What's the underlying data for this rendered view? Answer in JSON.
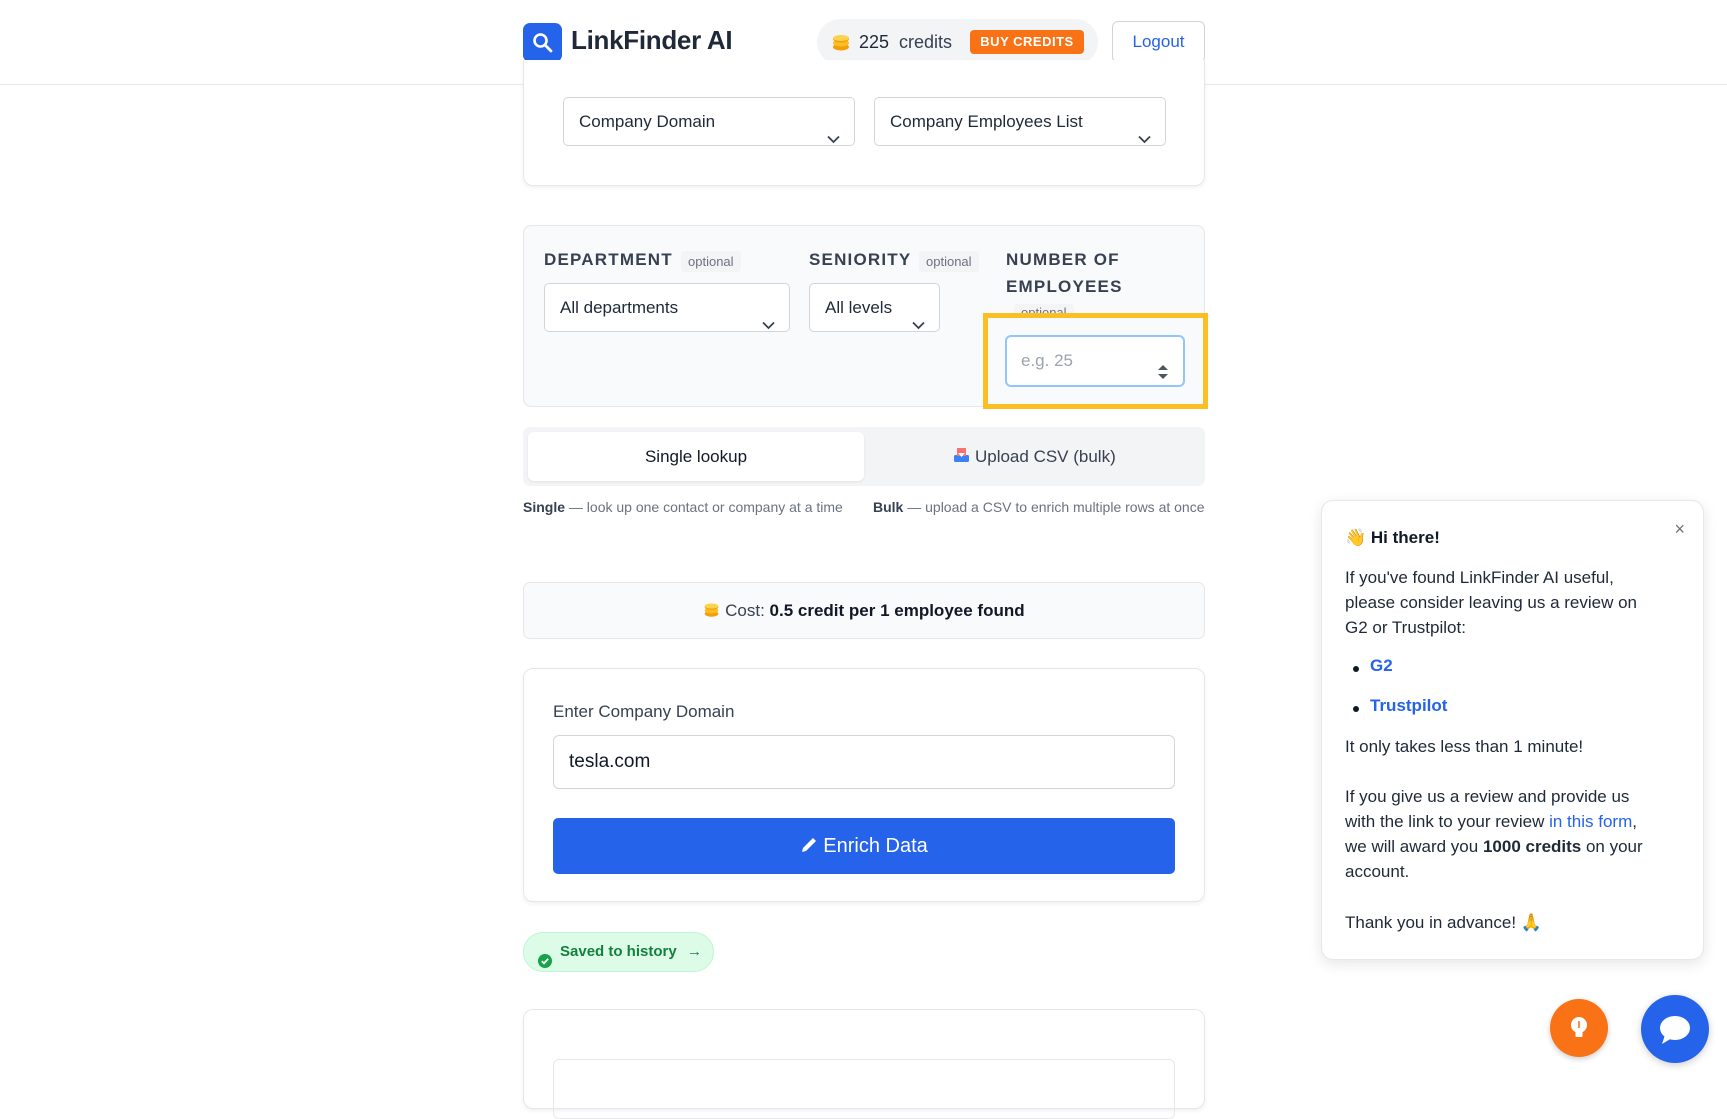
{
  "header": {
    "brand": "LinkFinder AI",
    "credits_count": "225",
    "credits_word": "credits",
    "buy_label": "BUY CREDITS",
    "logout_label": "Logout"
  },
  "source_selects": {
    "source_value": "Company Domain",
    "output_value": "Company Employees List"
  },
  "filters": {
    "department_label": "DEPARTMENT",
    "department_badge": "optional",
    "department_value": "All departments",
    "seniority_label": "SENIORITY",
    "seniority_badge": "optional",
    "seniority_value": "All levels",
    "employees_label_line1": "NUMBER OF",
    "employees_label_line2": "EMPLOYEES",
    "employees_badge": "optional",
    "employees_placeholder": "e.g. 25"
  },
  "mode_tabs": {
    "single_label": "Single lookup",
    "bulk_label": "Upload CSV (bulk)",
    "single_desc_bold": "Single",
    "single_desc": " — look up one contact or company at a time",
    "bulk_desc_bold": "Bulk",
    "bulk_desc": " — upload a CSV to enrich multiple rows at once"
  },
  "cost": {
    "prefix": "Cost: ",
    "value": "0.5 credit per 1 employee found"
  },
  "input_card": {
    "label": "Enter Company Domain",
    "value": "tesla.com",
    "button_label": "Enrich Data"
  },
  "saved": {
    "label": "Saved to history",
    "arrow": "→"
  },
  "popup": {
    "title_emoji": "👋",
    "title": "Hi there!",
    "close": "×",
    "intro_line1": "If you've found LinkFinder AI useful,",
    "intro_line2": "please consider leaving us a review on",
    "intro_line3": "G2 or Trustpilot:",
    "link_g2": "G2",
    "link_trustpilot": "Trustpilot",
    "time_note": "It only takes less than 1 minute!",
    "offer_line1": "If you give us a review and provide us",
    "offer_line2_a": "with the link to your review ",
    "offer_line2_link": "in this form",
    "offer_line2_b": ",",
    "offer_line3_a": "we will award you ",
    "offer_line3_bold": "1000 credits",
    "offer_line3_b": " on your",
    "offer_line4": "account.",
    "thanks": "Thank you in advance! 🙏"
  },
  "colors": {
    "primary": "#2563eb",
    "accent_orange": "#f97316",
    "highlight": "#fbbf24",
    "success": "#15803d"
  }
}
